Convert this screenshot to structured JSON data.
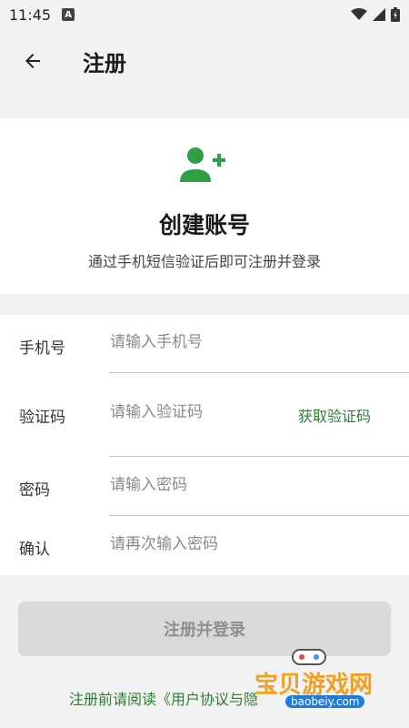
{
  "status": {
    "time": "11:45",
    "notif_icon_letter": "A"
  },
  "app_bar": {
    "back_icon": "arrow-left-icon",
    "title": "注册"
  },
  "hero": {
    "icon": "person-add-icon",
    "accent": "#2ea043",
    "title": "创建账号",
    "subtitle": "通过手机短信验证后即可注册并登录"
  },
  "form": {
    "phone": {
      "label": "手机号",
      "placeholder": "请输入手机号",
      "value": ""
    },
    "code": {
      "label": "验证码",
      "placeholder": "请输入验证码",
      "value": "",
      "button": "获取验证码"
    },
    "password": {
      "label": "密码",
      "placeholder": "请输入密码",
      "value": ""
    },
    "confirm": {
      "label": "确认",
      "placeholder": "请再次输入密码",
      "value": ""
    }
  },
  "submit": {
    "label": "注册并登录"
  },
  "agreement": {
    "text": "注册前请阅读《用户协议与隐"
  },
  "watermark": {
    "text": "宝贝游戏网",
    "url": "baobeiy.com"
  }
}
